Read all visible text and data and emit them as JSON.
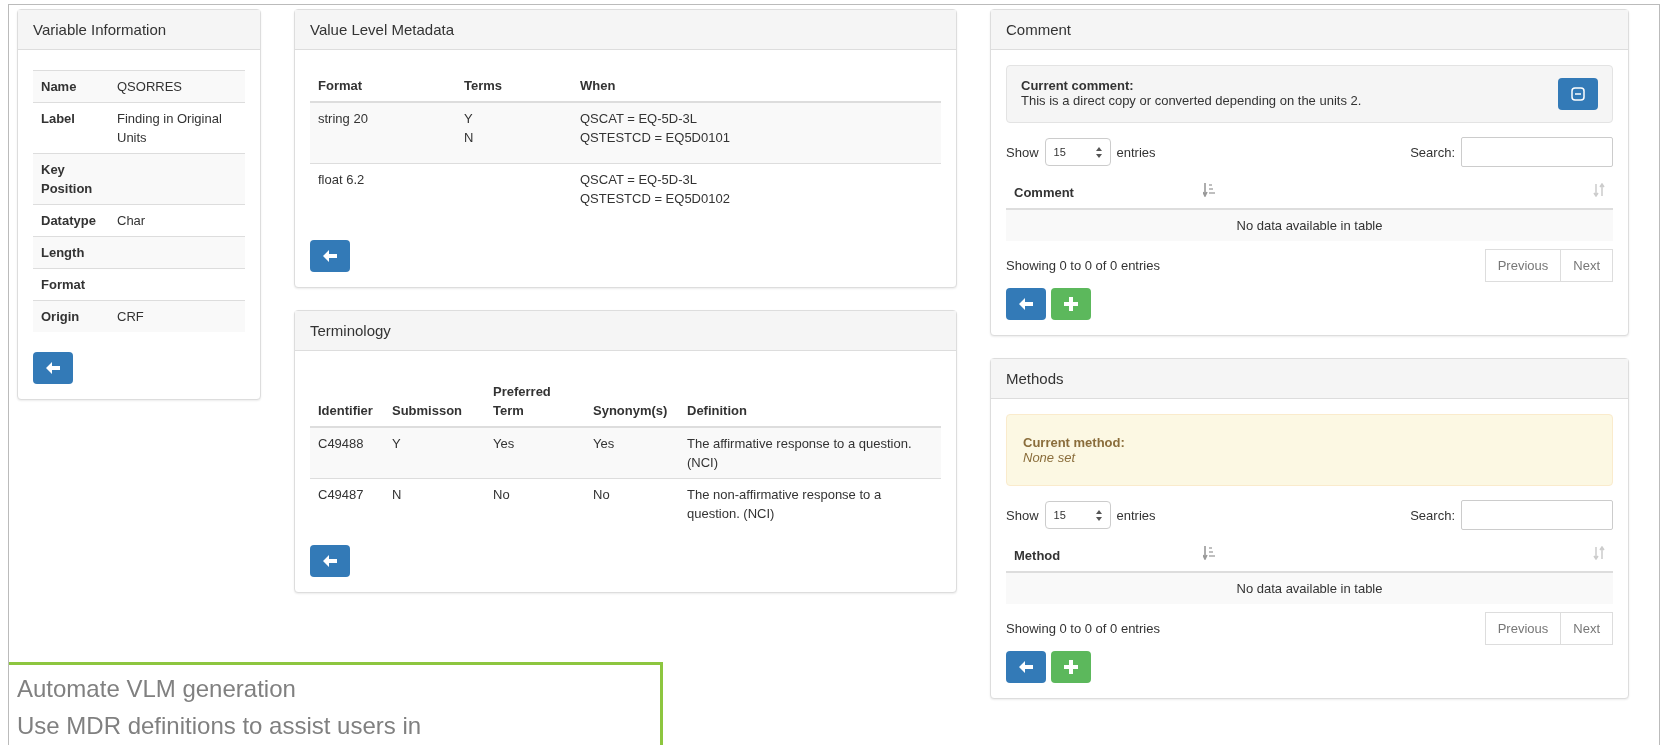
{
  "variable_information": {
    "title": "Variable Information",
    "rows": [
      {
        "label": "Name",
        "value": "QSORRES"
      },
      {
        "label": "Label",
        "value": "Finding in Original Units"
      },
      {
        "label": "Key Position",
        "value": ""
      },
      {
        "label": "Datatype",
        "value": "Char"
      },
      {
        "label": "Length",
        "value": ""
      },
      {
        "label": "Format",
        "value": ""
      },
      {
        "label": "Origin",
        "value": "CRF"
      }
    ]
  },
  "value_level_metadata": {
    "title": "Value Level Metadata",
    "columns": [
      "Format",
      "Terms",
      "When"
    ],
    "rows": [
      {
        "format": "string 20",
        "terms": [
          "Y",
          "N"
        ],
        "when": [
          "QSCAT = EQ-5D-3L",
          "QSTESTCD = EQ5D0101"
        ]
      },
      {
        "format": "float 6.2",
        "terms": [],
        "when": [
          "QSCAT = EQ-5D-3L",
          "QSTESTCD = EQ5D0102"
        ]
      }
    ]
  },
  "terminology": {
    "title": "Terminology",
    "columns": [
      "Identifier",
      "Submisson",
      "Preferred Term",
      "Synonym(s)",
      "Definition"
    ],
    "rows": [
      [
        "C49488",
        "Y",
        "Yes",
        "Yes",
        "The affirmative response to a question. (NCI)"
      ],
      [
        "C49487",
        "N",
        "No",
        "No",
        "The non-affirmative response to a question. (NCI)"
      ]
    ]
  },
  "comment": {
    "title": "Comment",
    "current": {
      "kind": "info",
      "label": "Current comment:",
      "text": "This is a direct copy or converted depending on the units 2."
    },
    "show_label": "Show",
    "page_size": "15",
    "entries_label": "entries",
    "search_label": "Search:",
    "column": "Comment",
    "empty": "No data available in table",
    "info": "Showing 0 to 0 of 0 entries",
    "pager": [
      "Previous",
      "Next"
    ]
  },
  "methods": {
    "title": "Methods",
    "current": {
      "kind": "warning",
      "label": "Current method:",
      "text": "None set"
    },
    "show_label": "Show",
    "page_size": "15",
    "entries_label": "entries",
    "search_label": "Search:",
    "column": "Method",
    "empty": "No data available in table",
    "info": "Showing 0 to 0 of 0 entries",
    "pager": [
      "Previous",
      "Next"
    ]
  },
  "callout": {
    "lines": [
      "Automate VLM generation",
      "Use MDR definitions to assist users in"
    ]
  }
}
